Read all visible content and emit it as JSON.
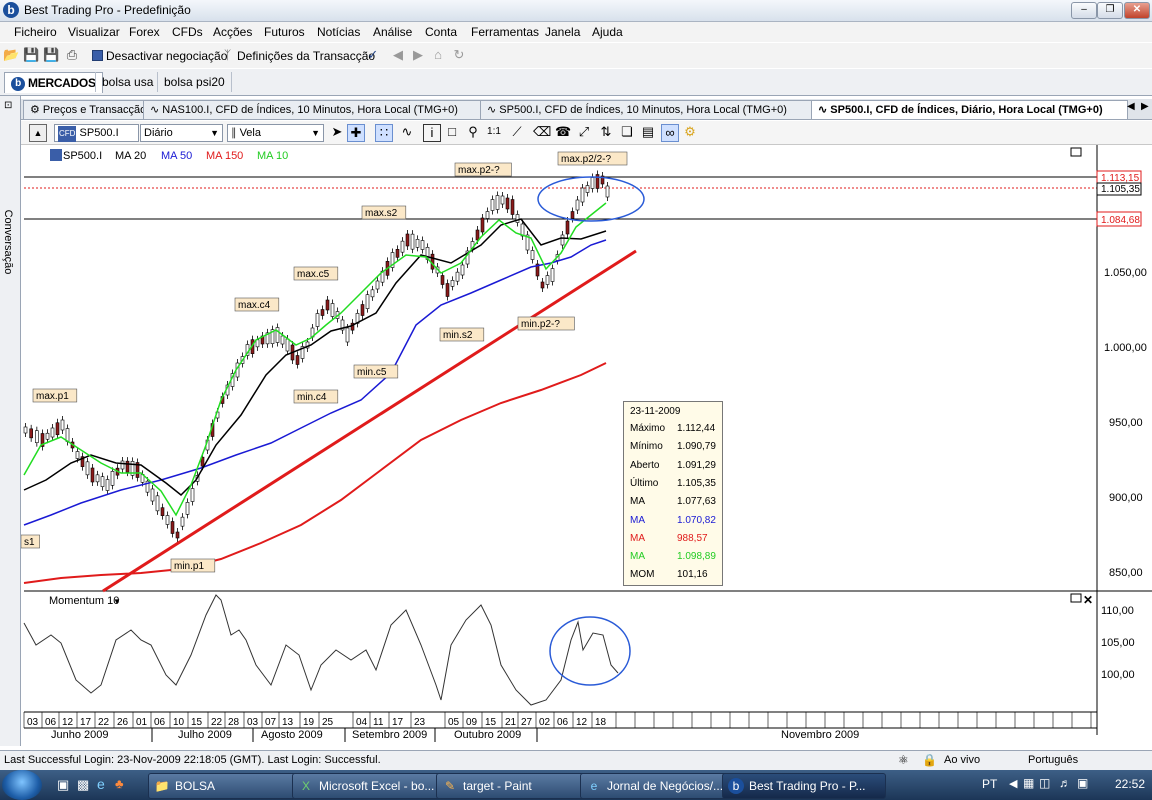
{
  "window": {
    "title": "Best Trading Pro - Predefinição",
    "app_icon": "b"
  },
  "menu": [
    "Ficheiro",
    "Visualizar",
    "Forex",
    "CFDs",
    "Acções",
    "Futuros",
    "Notícias",
    "Análise",
    "Conta",
    "Ferramentas",
    "Janela",
    "Ajuda"
  ],
  "toolbar": {
    "deactivate_label": "Desactivar negociação",
    "transaction_settings_label": "Definições da Transacção"
  },
  "main_tabs": [
    "MERCADOS",
    "bolsa usa",
    "bolsa psi20"
  ],
  "left_panel_label": "Conversação",
  "doc_tabs": [
    {
      "label": "Preços e Transacção",
      "active": false
    },
    {
      "label": "NAS100.I, CFD de Índices, 10 Minutos, Hora Local (TMG+0)",
      "active": false
    },
    {
      "label": "SP500.I, CFD de Índices, 10 Minutos, Hora Local (TMG+0)",
      "active": false
    },
    {
      "label": "SP500.I, CFD de Índices, Diário, Hora Local (TMG+0)",
      "active": true
    }
  ],
  "chart_toolbar": {
    "symbol": "SP500.I",
    "period": "Diário",
    "chart_style": "Vela"
  },
  "legend": {
    "symbol": "SP500.I",
    "ma20": "MA 20",
    "ma50": "MA 50",
    "ma150": "MA 150",
    "ma10": "MA 10"
  },
  "colors": {
    "ma20": "#000000",
    "ma50": "#1a1ad4",
    "ma150": "#e01b1b",
    "ma10": "#22dd22",
    "trend": "#e01b1b"
  },
  "price_axis_labels": [
    "1.050,00",
    "1.000,00",
    "950,00",
    "900,00",
    "850,00"
  ],
  "price_tags": {
    "top": "1.113,15",
    "last": "1.105,35",
    "level": "1.084,68"
  },
  "momentum": {
    "title": "Momentum 10",
    "axis_labels": [
      "110,00",
      "105,00",
      "100,00"
    ]
  },
  "annotations": [
    "max.p2-?",
    "max.p2/2-?",
    "max.s2",
    "max.c5",
    "max.c4",
    "max.p1",
    "min.s2",
    "min.p2-?",
    "min.c5",
    "min.c4",
    "min.p1",
    "s1"
  ],
  "info_box": {
    "date": "23-11-2009",
    "rows": [
      {
        "label": "Máximo",
        "value": "1.112,44",
        "color": "#000000"
      },
      {
        "label": "Mínimo",
        "value": "1.090,79",
        "color": "#000000"
      },
      {
        "label": "Aberto",
        "value": "1.091,29",
        "color": "#000000"
      },
      {
        "label": "Último",
        "value": "1.105,35",
        "color": "#000000"
      },
      {
        "label": "MA",
        "value": "1.077,63",
        "color": "#000000"
      },
      {
        "label": "MA",
        "value": "1.070,82",
        "color": "#1a1ad4"
      },
      {
        "label": "MA",
        "value": "988,57",
        "color": "#e01b1b"
      },
      {
        "label": "MA",
        "value": "1.098,89",
        "color": "#22cc22"
      },
      {
        "label": "MOM",
        "value": "101,16",
        "color": "#000000"
      }
    ]
  },
  "x_axis": {
    "days": [
      "03",
      "06",
      "12",
      "17",
      "22",
      "26",
      "01",
      "06",
      "10",
      "15",
      "22",
      "28",
      "03",
      "07",
      "13",
      "19",
      "25",
      "04",
      "11",
      "17",
      "23",
      "05",
      "09",
      "15",
      "21",
      "27",
      "02",
      "06",
      "12",
      "18"
    ],
    "months": [
      "Junho 2009",
      "Julho 2009",
      "Agosto 2009",
      "Setembro 2009",
      "Outubro 2009",
      "Novembro 2009"
    ]
  },
  "status": {
    "message": "Last Successful Login: 23-Nov-2009 22:18:05 (GMT). Last Login: Successful.",
    "mode": "Ao vivo",
    "language": "Português"
  },
  "taskbar": {
    "items": [
      {
        "label": "BOLSA",
        "icon": "folder-icon"
      },
      {
        "label": "Microsoft Excel - bo...",
        "icon": "excel-icon"
      },
      {
        "label": "target - Paint",
        "icon": "paint-icon"
      },
      {
        "label": "Jornal de Negócios/...",
        "icon": "ie-icon"
      },
      {
        "label": "Best Trading Pro - P...",
        "icon": "bt-icon",
        "active": true
      }
    ],
    "lang": "PT",
    "time": "22:52"
  }
}
